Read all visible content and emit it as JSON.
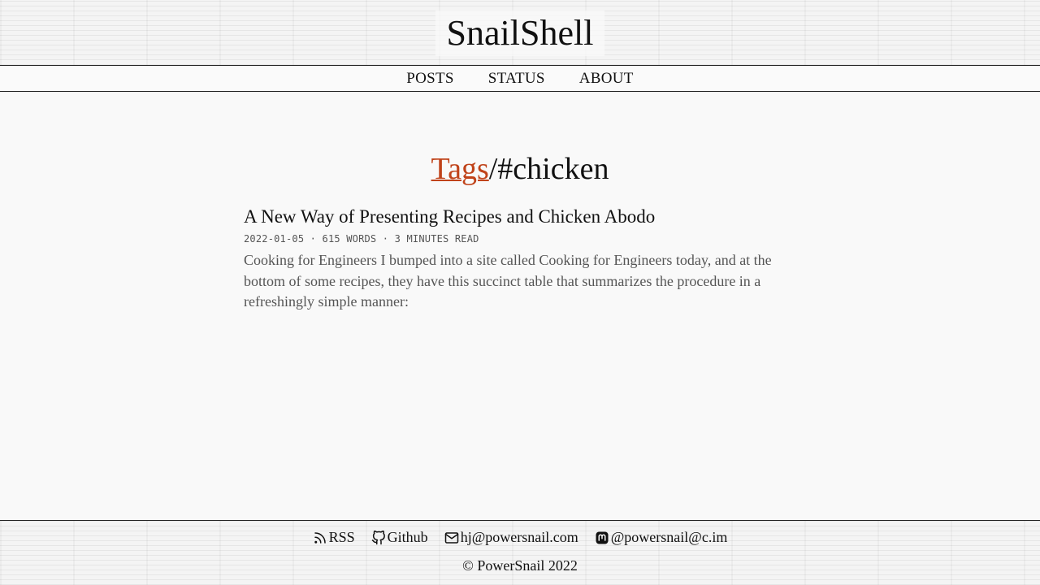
{
  "site": {
    "title": "SnailShell"
  },
  "nav": {
    "items": [
      {
        "label": "POSTS"
      },
      {
        "label": "STATUS"
      },
      {
        "label": "ABOUT"
      }
    ]
  },
  "page": {
    "heading_link": "Tags",
    "heading_rest": "/#chicken"
  },
  "posts": [
    {
      "title": "A New Way of Presenting Recipes and Chicken Abodo",
      "meta": "2022-01-05 · 615 WORDS · 3 MINUTES READ",
      "summary": "Cooking for Engineers I bumped into a site called Cooking for Engineers today, and at the bottom of some recipes, they have this succinct table that summarizes the procedure in a refreshingly simple manner:"
    }
  ],
  "footer": {
    "links": [
      {
        "label": "RSS",
        "icon": "rss-icon"
      },
      {
        "label": "Github",
        "icon": "github-icon"
      },
      {
        "label": "hj@powersnail.com",
        "icon": "mail-icon"
      },
      {
        "label": "@powersnail@c.im",
        "icon": "mastodon-icon"
      }
    ],
    "copyright": "© PowerSnail 2022"
  },
  "colors": {
    "accent": "#c0431a",
    "text": "#111111",
    "muted": "#555555",
    "background": "#f9f9f9"
  }
}
